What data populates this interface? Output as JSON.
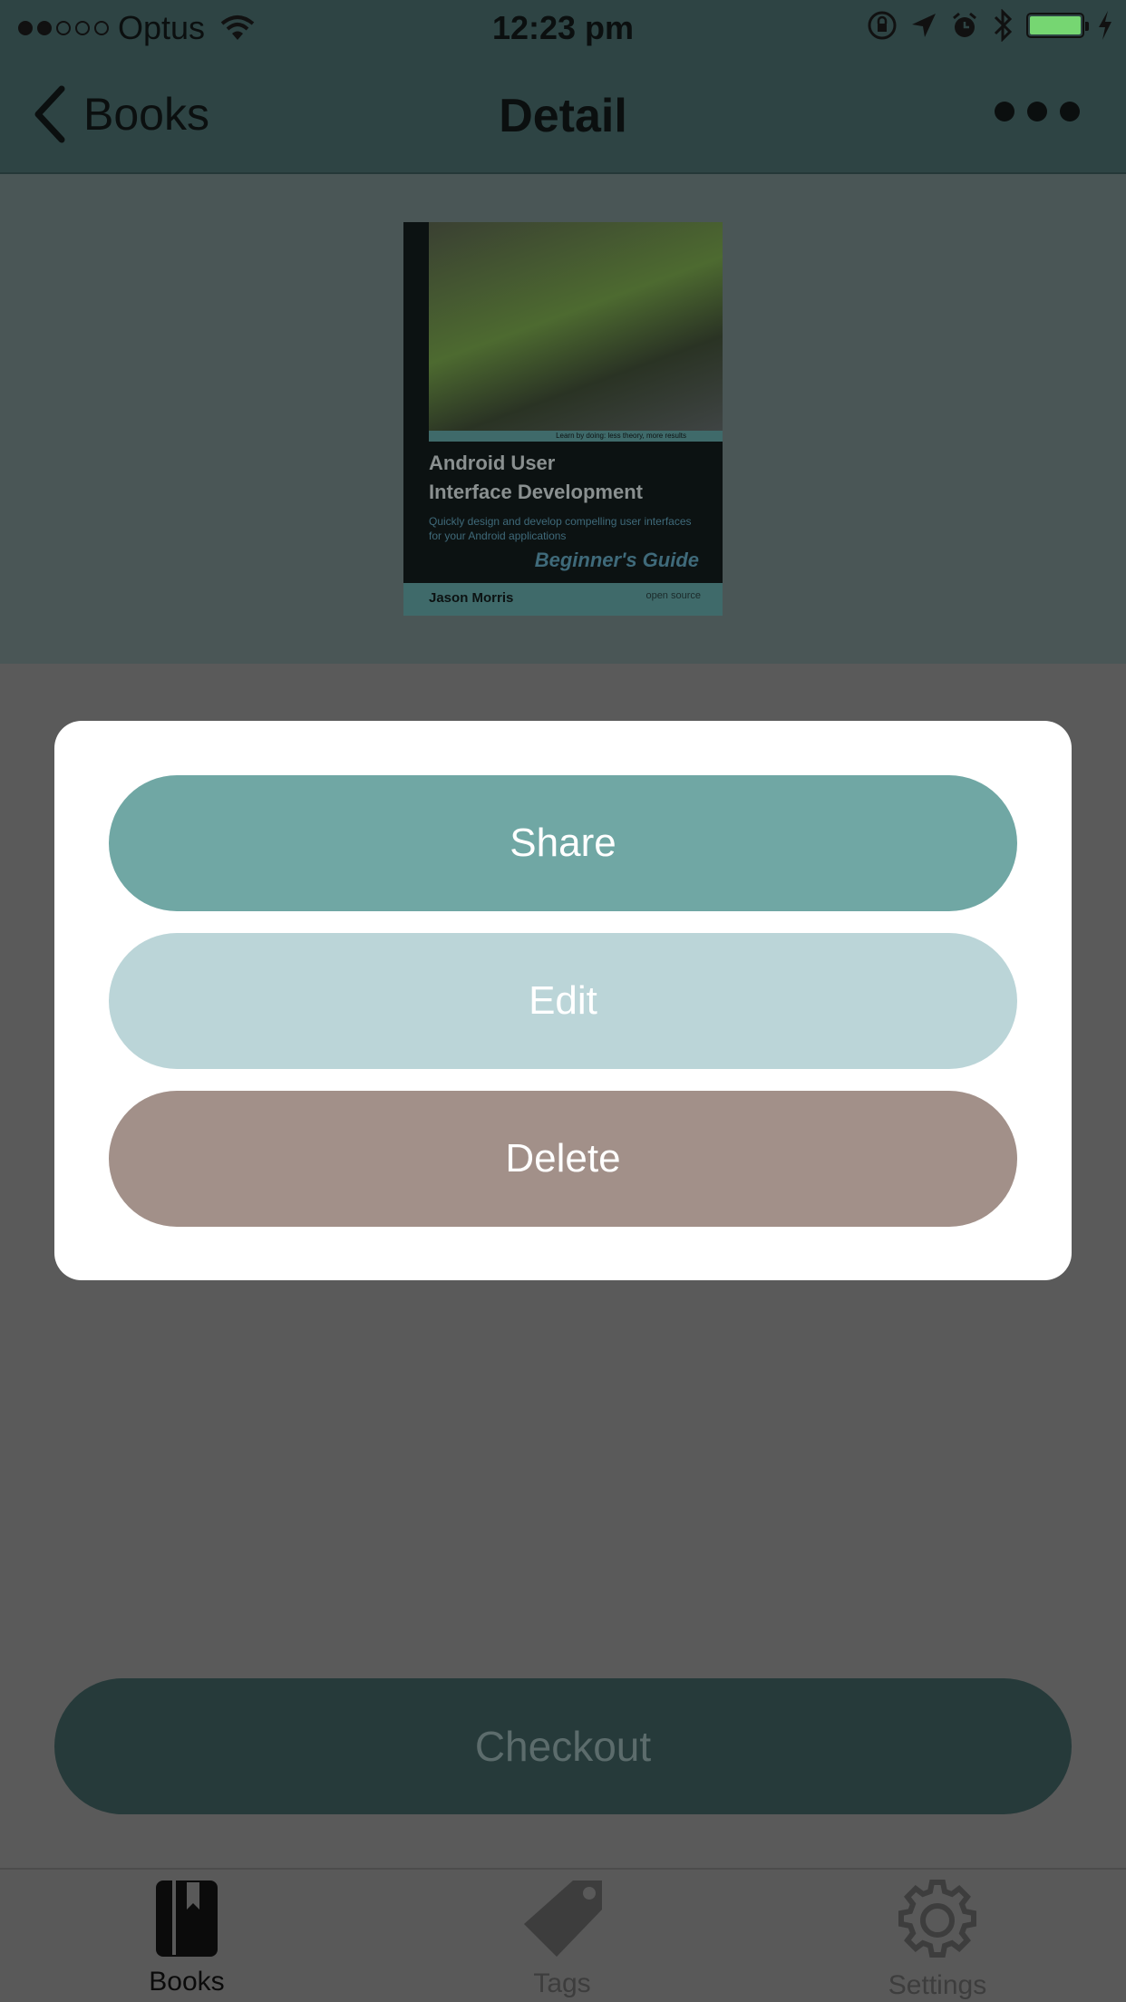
{
  "status_bar": {
    "signal_filled": 2,
    "signal_total": 5,
    "carrier": "Optus",
    "time": "12:23 pm",
    "battery_color": "#76d672"
  },
  "nav": {
    "back_label": "Books",
    "title": "Detail",
    "more_icon": "ellipsis-icon"
  },
  "book_cover": {
    "title_line1": "Android User",
    "title_line2": "Interface Development",
    "tagline": "Learn by doing: less theory, more results",
    "subtitle": "Quickly design and develop compelling user interfaces for your Android applications",
    "series": "Beginner's Guide",
    "author": "Jason Morris",
    "publisher_badge": "open source"
  },
  "action_sheet": {
    "share_label": "Share",
    "edit_label": "Edit",
    "delete_label": "Delete",
    "share_color": "#70a7a4",
    "edit_color": "#bbd5d8",
    "delete_color": "#a29089"
  },
  "checkout": {
    "label": "Checkout"
  },
  "tab_bar": {
    "items": [
      {
        "label": "Books",
        "icon": "bookmark-book-icon",
        "selected": true
      },
      {
        "label": "Tags",
        "icon": "tag-icon",
        "selected": false
      },
      {
        "label": "Settings",
        "icon": "gear-icon",
        "selected": false
      }
    ]
  }
}
